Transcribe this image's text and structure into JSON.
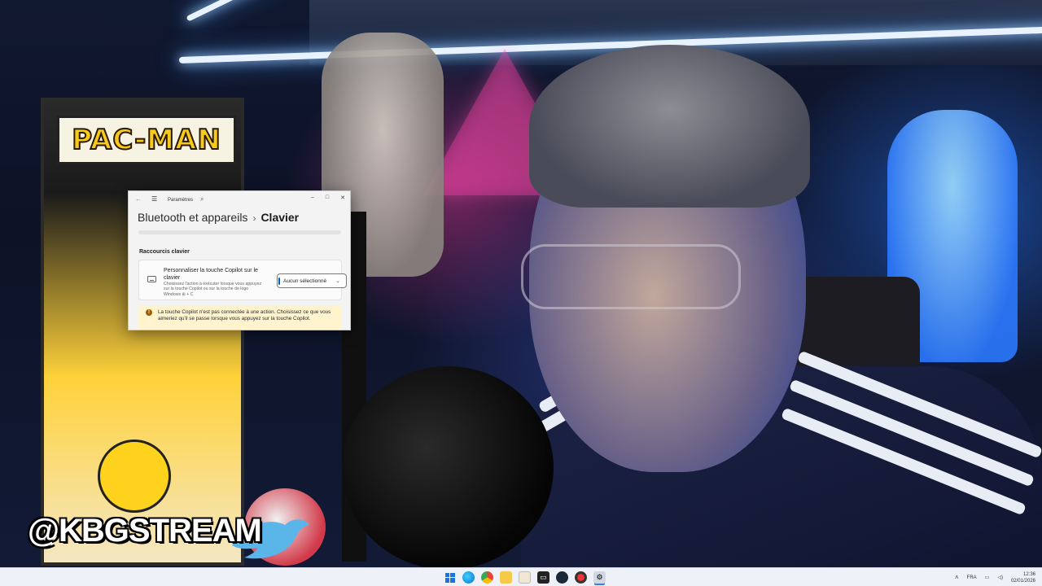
{
  "overlay": {
    "handle": "@KBGSTREAM",
    "arcade_sign": "PAC-MAN"
  },
  "settings_window": {
    "app_title": "Paramètres",
    "breadcrumb_parent": "Bluetooth et appareils",
    "breadcrumb_current": "Clavier",
    "section_label": "Raccourcis clavier",
    "copilot_setting": {
      "title": "Personnaliser la touche Copilot sur le clavier",
      "description": "Choisissez l'action à exécuter lorsque vous appuyez sur la touche Copilot ou sur la touche de logo Windows ⊞ + C",
      "dropdown_value": "Aucun sélectionné"
    },
    "warning_text": "La touche Copilot n'est pas connectée à une action. Choisissez ce que vous aimeriez qu'il se passe lorsque vous appuyez sur la touche Copilot.",
    "controls": {
      "minimize": "–",
      "maximize": "□",
      "close": "✕"
    }
  },
  "taskbar": {
    "apps": [
      "start",
      "edge",
      "chrome",
      "file-explorer",
      "media-player",
      "terminal",
      "steam",
      "obs",
      "settings"
    ],
    "language": "FRA",
    "time": "12:36",
    "date": "02/01/2026"
  },
  "colors": {
    "accent": "#005fb8",
    "warning_bg": "#fff4ce",
    "warning_icon": "#9d5d00"
  }
}
